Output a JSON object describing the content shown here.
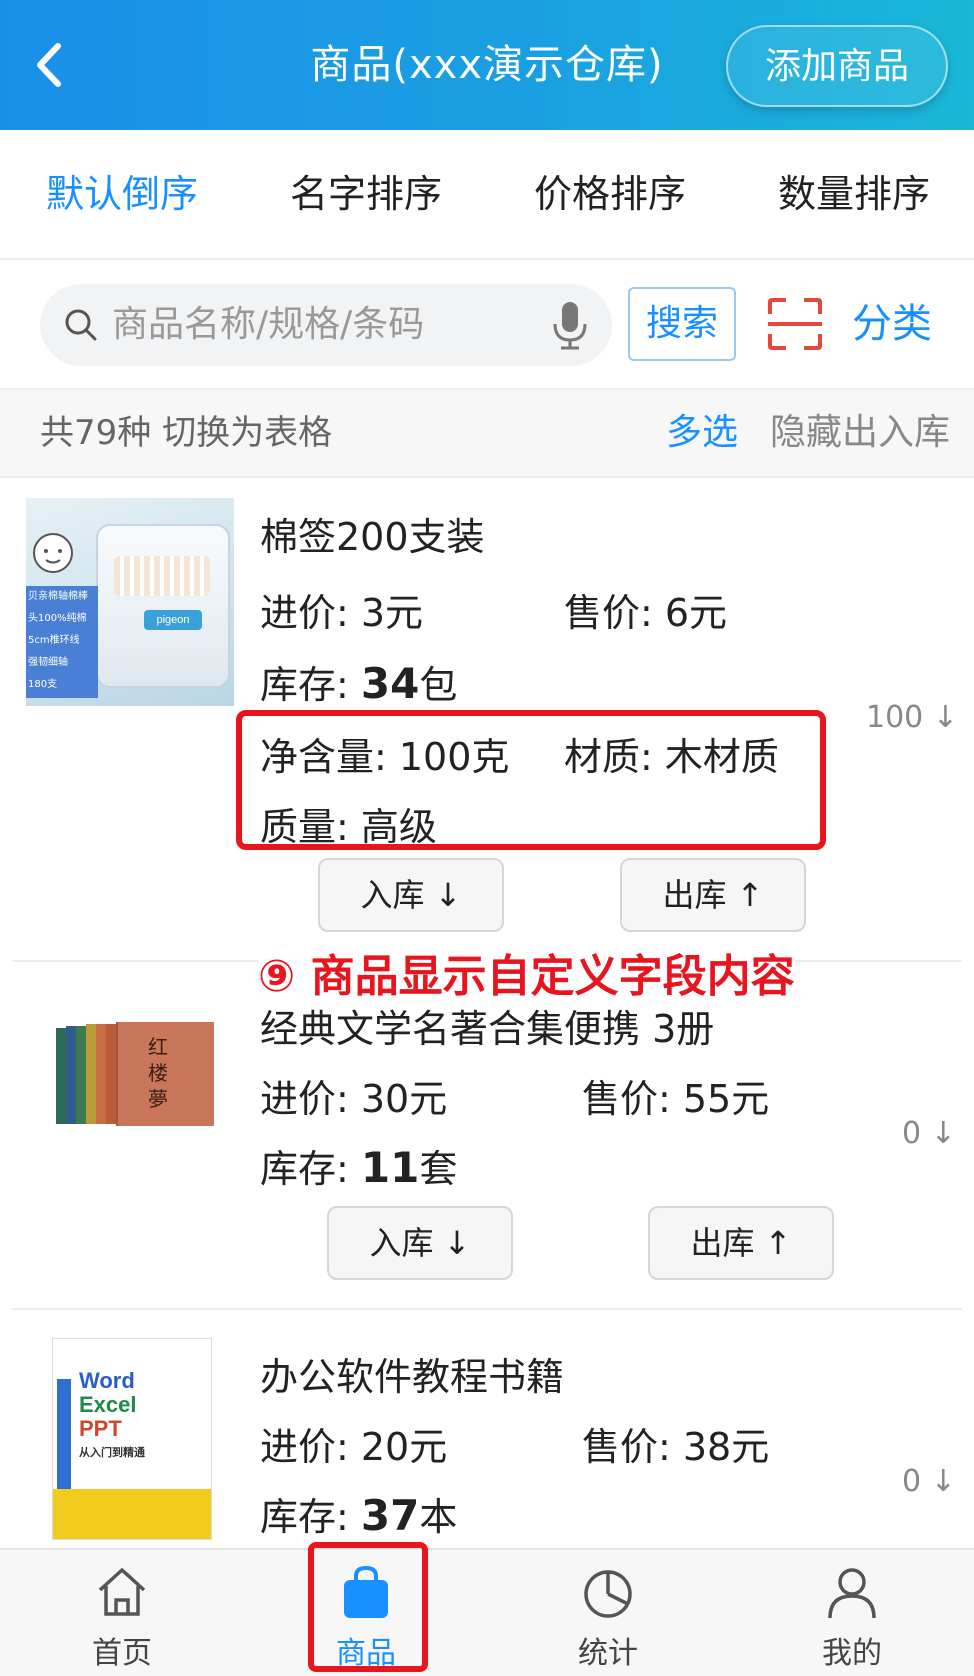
{
  "header": {
    "title": "商品(xxx演示仓库)",
    "add_button": "添加商品"
  },
  "sort_tabs": [
    "默认倒序",
    "名字排序",
    "价格排序",
    "数量排序"
  ],
  "search": {
    "placeholder": "商品名称/规格/条码",
    "button": "搜索",
    "category": "分类"
  },
  "summary": {
    "count_text": "共79种",
    "switch_table": "切换为表格",
    "multi_select": "多选",
    "hide_inout": "隐藏出入库"
  },
  "annotation": "⑨ 商品显示自定义字段内容",
  "products": [
    {
      "name": "棉签200支装",
      "cost": "进价: 3元",
      "price": "售价: 6元",
      "stock_label": "库存: ",
      "stock_num": "34",
      "stock_unit": "包",
      "custom1": "净含量:  100克",
      "custom2": "材质:  木材质",
      "custom3": "质量:  高级",
      "right_count": "100 ↓",
      "in_btn": "入库 ↓",
      "out_btn": "出库 ↑",
      "thumb_text": [
        "贝亲棉轴棉棒",
        "头100%纯棉",
        "5cm椎环线",
        "强韧细轴",
        "180支"
      ]
    },
    {
      "name": "经典文学名著合集便携  3册",
      "cost": "进价: 30元",
      "price": "售价: 55元",
      "stock_label": "库存: ",
      "stock_num": "11",
      "stock_unit": "套",
      "right_count": "0 ↓",
      "in_btn": "入库 ↓",
      "out_btn": "出库 ↑",
      "thumb_text": [
        "红",
        "楼",
        "夢"
      ]
    },
    {
      "name": "办公软件教程书籍",
      "cost": "进价: 20元",
      "price": "售价: 38元",
      "stock_label": "库存: ",
      "stock_num": "37",
      "stock_unit": "本",
      "right_count": "0 ↓",
      "thumb_text": [
        "Word",
        "Excel",
        "PPT",
        "从入门到精通"
      ]
    }
  ],
  "bottom_nav": [
    "首页",
    "商品",
    "统计",
    "我的"
  ],
  "colors": {
    "accent": "#1890ff",
    "header_start": "#1a8fe8",
    "header_end": "#1ab7d8",
    "highlight_red": "#e8141e"
  }
}
